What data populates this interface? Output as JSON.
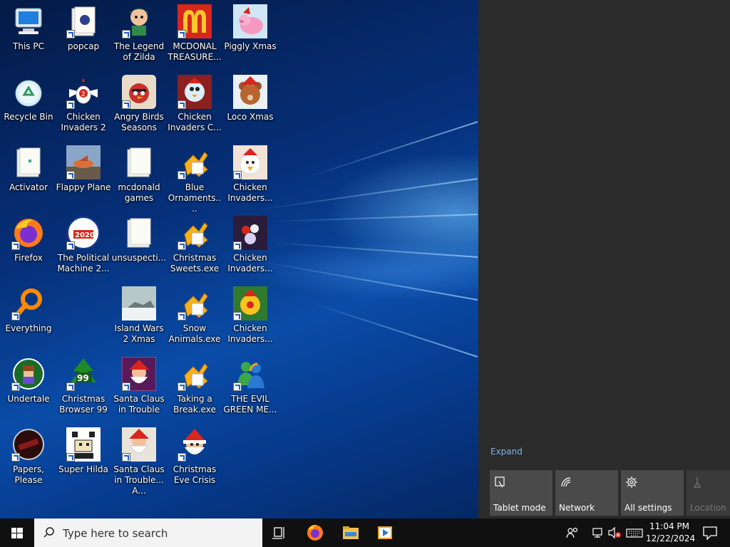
{
  "desktop": {
    "icons": [
      {
        "label": "This PC",
        "icon": "computer-icon"
      },
      {
        "label": "popcap",
        "icon": "folder-icon"
      },
      {
        "label": "The Legend of Zilda",
        "icon": "game-icon"
      },
      {
        "label": "MCDONAL TREASURE...",
        "icon": "mcdonalds-icon"
      },
      {
        "label": "Piggly Xmas",
        "icon": "pig-icon"
      },
      {
        "label": "Recycle Bin",
        "icon": "recycle-bin-icon"
      },
      {
        "label": "Chicken Invaders 2",
        "icon": "chicken-icon"
      },
      {
        "label": "Angry Birds Seasons",
        "icon": "angry-bird-icon"
      },
      {
        "label": "Chicken Invaders C...",
        "icon": "chicken-icon"
      },
      {
        "label": "Loco Xmas",
        "icon": "teddy-bear-icon"
      },
      {
        "label": "Activator",
        "icon": "folder-icon"
      },
      {
        "label": "Flappy Plane",
        "icon": "plane-icon"
      },
      {
        "label": "mcdonald games",
        "icon": "folder-icon"
      },
      {
        "label": "Blue Ornaments....",
        "icon": "puzzle-icon"
      },
      {
        "label": "Chicken Invaders...",
        "icon": "chicken-icon"
      },
      {
        "label": "Firefox",
        "icon": "firefox-icon"
      },
      {
        "label": "The Political Machine 2...",
        "icon": "political-icon"
      },
      {
        "label": "unsuspecti...",
        "icon": "folder-icon"
      },
      {
        "label": "Christmas Sweets.exe",
        "icon": "puzzle-icon"
      },
      {
        "label": "Chicken Invaders...",
        "icon": "chicken-icon"
      },
      {
        "label": "Everything",
        "icon": "magnifier-icon"
      },
      {
        "label": "Island Wars 2 Xmas",
        "icon": "island-icon"
      },
      {
        "label": "Snow Animals.exe",
        "icon": "puzzle-icon"
      },
      {
        "label": "Chicken Invaders...",
        "icon": "chicken-icon"
      },
      {
        "label": "Undertale",
        "icon": "undertale-icon"
      },
      {
        "label": "Christmas Browser 99",
        "icon": "tree-icon"
      },
      {
        "label": "Santa Claus in Trouble",
        "icon": "santa-icon"
      },
      {
        "label": "Taking a Break.exe",
        "icon": "puzzle-icon"
      },
      {
        "label": "THE EVIL GREEN ME...",
        "icon": "messenger-icon"
      },
      {
        "label": "Papers, Please",
        "icon": "papers-please-icon"
      },
      {
        "label": "Super Hilda",
        "icon": "pixel-icon"
      },
      {
        "label": "Santa Claus in Trouble... A...",
        "icon": "santa-icon"
      },
      {
        "label": "Christmas Eve Crisis",
        "icon": "santa-icon"
      }
    ]
  },
  "action_center": {
    "expand_label": "Expand",
    "tiles": [
      {
        "label": "Tablet mode",
        "icon": "tablet-mode-icon"
      },
      {
        "label": "Network",
        "icon": "network-icon"
      },
      {
        "label": "All settings",
        "icon": "gear-icon"
      },
      {
        "label": "Location",
        "icon": "location-icon"
      }
    ]
  },
  "taskbar": {
    "search_placeholder": "Type here to search",
    "time": "11:04 PM",
    "date": "12/22/2024"
  },
  "colors": {
    "accent": "#0a4ca8",
    "action_center_bg": "#2b2b2b",
    "tile_bg": "#4a4a4a",
    "taskbar_bg": "#101010",
    "link": "#7fb2e6"
  }
}
